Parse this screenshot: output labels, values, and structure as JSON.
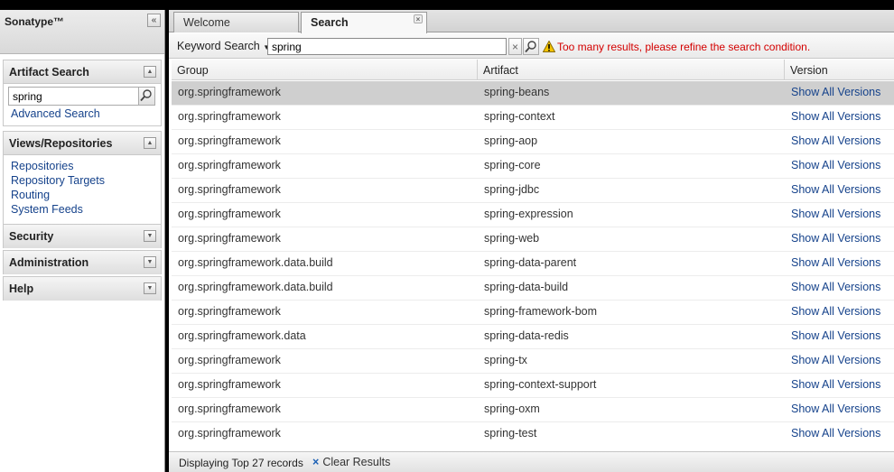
{
  "app": {
    "brand": "Sonatype™"
  },
  "sidebar": {
    "artifact_search": {
      "title": "Artifact Search",
      "search_value": "spring",
      "advanced_link": "Advanced Search"
    },
    "views": {
      "title": "Views/Repositories",
      "links": [
        "Repositories",
        "Repository Targets",
        "Routing",
        "System Feeds"
      ]
    },
    "security": {
      "title": "Security"
    },
    "administration": {
      "title": "Administration"
    },
    "help": {
      "title": "Help"
    }
  },
  "tabs": [
    {
      "label": "Welcome",
      "active": false
    },
    {
      "label": "Search",
      "active": true
    }
  ],
  "toolbar": {
    "keyword_label": "Keyword Search",
    "keyword_value": "spring",
    "warning": "Too many results, please refine the search condition."
  },
  "grid": {
    "columns": [
      "Group",
      "Artifact",
      "Version"
    ],
    "rows": [
      {
        "group": "org.springframework",
        "artifact": "spring-beans",
        "version": "Show All Versions"
      },
      {
        "group": "org.springframework",
        "artifact": "spring-context",
        "version": "Show All Versions"
      },
      {
        "group": "org.springframework",
        "artifact": "spring-aop",
        "version": "Show All Versions"
      },
      {
        "group": "org.springframework",
        "artifact": "spring-core",
        "version": "Show All Versions"
      },
      {
        "group": "org.springframework",
        "artifact": "spring-jdbc",
        "version": "Show All Versions"
      },
      {
        "group": "org.springframework",
        "artifact": "spring-expression",
        "version": "Show All Versions"
      },
      {
        "group": "org.springframework",
        "artifact": "spring-web",
        "version": "Show All Versions"
      },
      {
        "group": "org.springframework.data.build",
        "artifact": "spring-data-parent",
        "version": "Show All Versions"
      },
      {
        "group": "org.springframework.data.build",
        "artifact": "spring-data-build",
        "version": "Show All Versions"
      },
      {
        "group": "org.springframework",
        "artifact": "spring-framework-bom",
        "version": "Show All Versions"
      },
      {
        "group": "org.springframework.data",
        "artifact": "spring-data-redis",
        "version": "Show All Versions"
      },
      {
        "group": "org.springframework",
        "artifact": "spring-tx",
        "version": "Show All Versions"
      },
      {
        "group": "org.springframework",
        "artifact": "spring-context-support",
        "version": "Show All Versions"
      },
      {
        "group": "org.springframework",
        "artifact": "spring-oxm",
        "version": "Show All Versions"
      },
      {
        "group": "org.springframework",
        "artifact": "spring-test",
        "version": "Show All Versions"
      }
    ]
  },
  "status": {
    "records_text": "Displaying Top 27 records",
    "clear_label": "Clear Results"
  }
}
